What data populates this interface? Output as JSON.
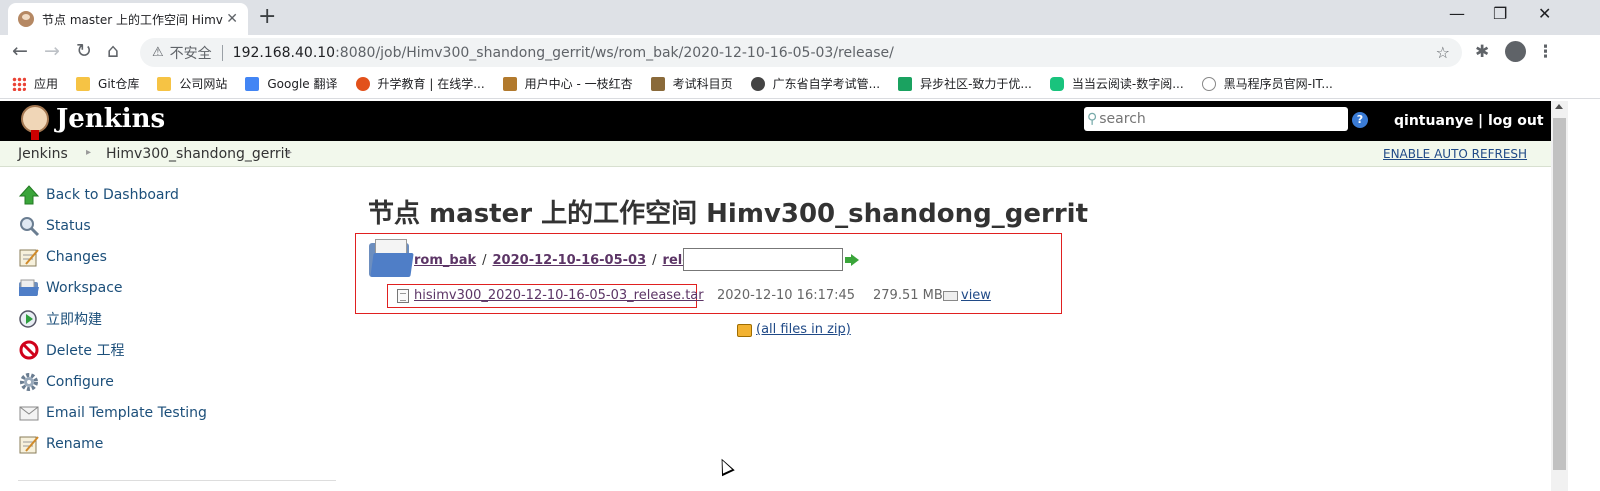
{
  "browser": {
    "tab_title": "节点 master 上的工作空间 Himv",
    "tab_close": "✕",
    "new_tab": "+",
    "window_min": "—",
    "window_restore": "❐",
    "window_close": "✕",
    "insecure_label": "不安全",
    "url_host": "192.168.40.10",
    "url_path": ":8080/job/Himv300_shandong_gerrit/ws/rom_bak/2020-12-10-16-05-03/release/",
    "icons": {
      "back": "arrow-left-icon",
      "forward": "arrow-right-icon",
      "reload": "reload-icon",
      "home": "home-icon",
      "warning": "warning-icon",
      "bookmark_star": "star-icon",
      "extensions": "puzzle-icon",
      "profile": "avatar-icon",
      "menu": "kebab-menu-icon"
    }
  },
  "bookmarks": [
    {
      "label": "应用",
      "color": "#4285f4"
    },
    {
      "label": "Git仓库",
      "color": "#f6c344"
    },
    {
      "label": "公司网站",
      "color": "#f6c344"
    },
    {
      "label": "Google 翻译",
      "color": "#4285f4"
    },
    {
      "label": "升学教育 | 在线学...",
      "color": "#e2511b"
    },
    {
      "label": "用户中心 - 一枝红杏",
      "color": "#b27a2d"
    },
    {
      "label": "考试科目页",
      "color": "#8a6a3a"
    },
    {
      "label": "广东省自学考试管...",
      "color": "#444444"
    },
    {
      "label": "异步社区-致力于优...",
      "color": "#1aa260"
    },
    {
      "label": "当当云阅读-数字阅...",
      "color": "#19c37d"
    },
    {
      "label": "黑马程序员官网-IT...",
      "color": "#888888"
    }
  ],
  "jenkins": {
    "brand": "Jenkins",
    "search_placeholder": "search",
    "help_glyph": "?",
    "username": "qintuanye",
    "logout": "| log out",
    "breadcrumbs": [
      "Jenkins",
      "Himv300_shandong_gerrit"
    ],
    "enable_auto_refresh": "ENABLE AUTO REFRESH"
  },
  "sidebar": {
    "items": [
      {
        "label": "Back to Dashboard",
        "icon": "up-arrow-icon"
      },
      {
        "label": "Status",
        "icon": "magnifier-icon"
      },
      {
        "label": "Changes",
        "icon": "notepad-icon"
      },
      {
        "label": "Workspace",
        "icon": "folder-icon"
      },
      {
        "label": "立即构建",
        "icon": "build-clock-icon"
      },
      {
        "label": "Delete 工程",
        "icon": "no-entry-icon"
      },
      {
        "label": "Configure",
        "icon": "gear-icon"
      },
      {
        "label": "Email Template Testing",
        "icon": "envelope-icon"
      },
      {
        "label": "Rename",
        "icon": "notepad-icon"
      }
    ]
  },
  "main": {
    "title": "节点 master 上的工作空间 Himv300_shandong_gerrit",
    "path": [
      "rom_bak",
      "2020-12-10-16-05-03",
      "release"
    ],
    "path_separator": "/",
    "file": {
      "name": "hisimv300_2020-12-10-16-05-03_release.tar",
      "date": "2020-12-10 16:17:45",
      "size": "279.51 MB",
      "view_label": "view"
    },
    "all_files_zip": "(all files in zip)"
  },
  "colors": {
    "jenkins_header_bg": "#000000",
    "breadcrumb_bg": "#f2f8ec",
    "highlight_border": "#e02020",
    "link": "#204a87",
    "visited_link": "#5c3566"
  }
}
